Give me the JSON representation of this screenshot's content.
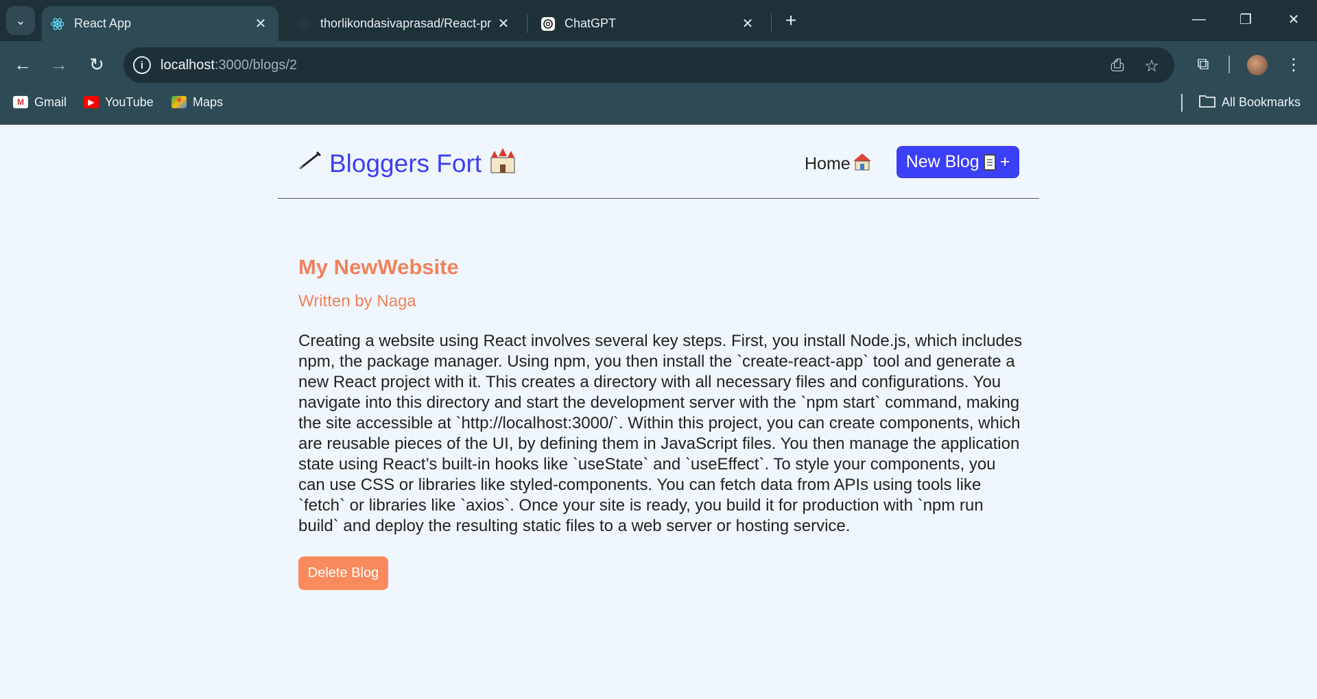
{
  "browser": {
    "tabs": [
      {
        "title": "React App",
        "active": true
      },
      {
        "title": "thorlikondasivaprasad/React-pr",
        "active": false
      },
      {
        "title": "ChatGPT",
        "active": false
      }
    ],
    "url_host": "localhost",
    "url_path": ":3000/blogs/2",
    "bookmarks": [
      {
        "label": "Gmail",
        "icon": "gmail-icon"
      },
      {
        "label": "YouTube",
        "icon": "youtube-icon"
      },
      {
        "label": "Maps",
        "icon": "maps-icon"
      }
    ],
    "all_bookmarks": "All Bookmarks"
  },
  "site": {
    "brand": "Bloggers Fort",
    "home": "Home",
    "new_blog": "New Blog",
    "new_blog_plus": "+",
    "accent": "#3b3ff6"
  },
  "blog": {
    "title": "My NewWebsite",
    "author": "Written by Naga",
    "body": "Creating a website using React involves several key steps. First, you install Node.js, which includes npm, the package manager. Using npm, you then install the `create-react-app` tool and generate a new React project with it. This creates a directory with all necessary files and configurations. You navigate into this directory and start the development server with the `npm start` command, making the site accessible at `http://localhost:3000/`. Within this project, you can create components, which are reusable pieces of the UI, by defining them in JavaScript files. You then manage the application state using React’s built-in hooks like `useState` and `useEffect`. To style your components, you can use CSS or libraries like styled-components. You can fetch data from APIs using tools like `fetch` or libraries like `axios`. Once your site is ready, you build it for production with `npm run build` and deploy the resulting static files to a web server or hosting service.",
    "delete_label": "Delete Blog",
    "accent": "#f1825b"
  }
}
